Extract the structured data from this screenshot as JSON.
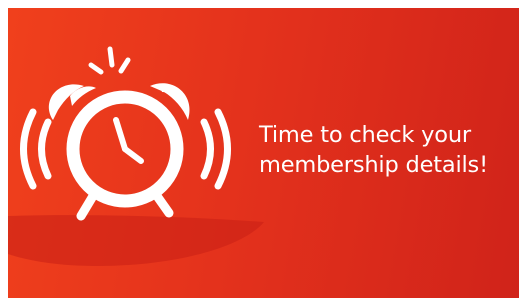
{
  "banner": {
    "headline": {
      "line1": "Time to check your",
      "line2": "membership details!"
    },
    "icon": "alarm-clock-ringing-icon",
    "colors": {
      "background_start": "#f0401c",
      "background_end": "#d0231a",
      "foreground": "#ffffff"
    }
  }
}
